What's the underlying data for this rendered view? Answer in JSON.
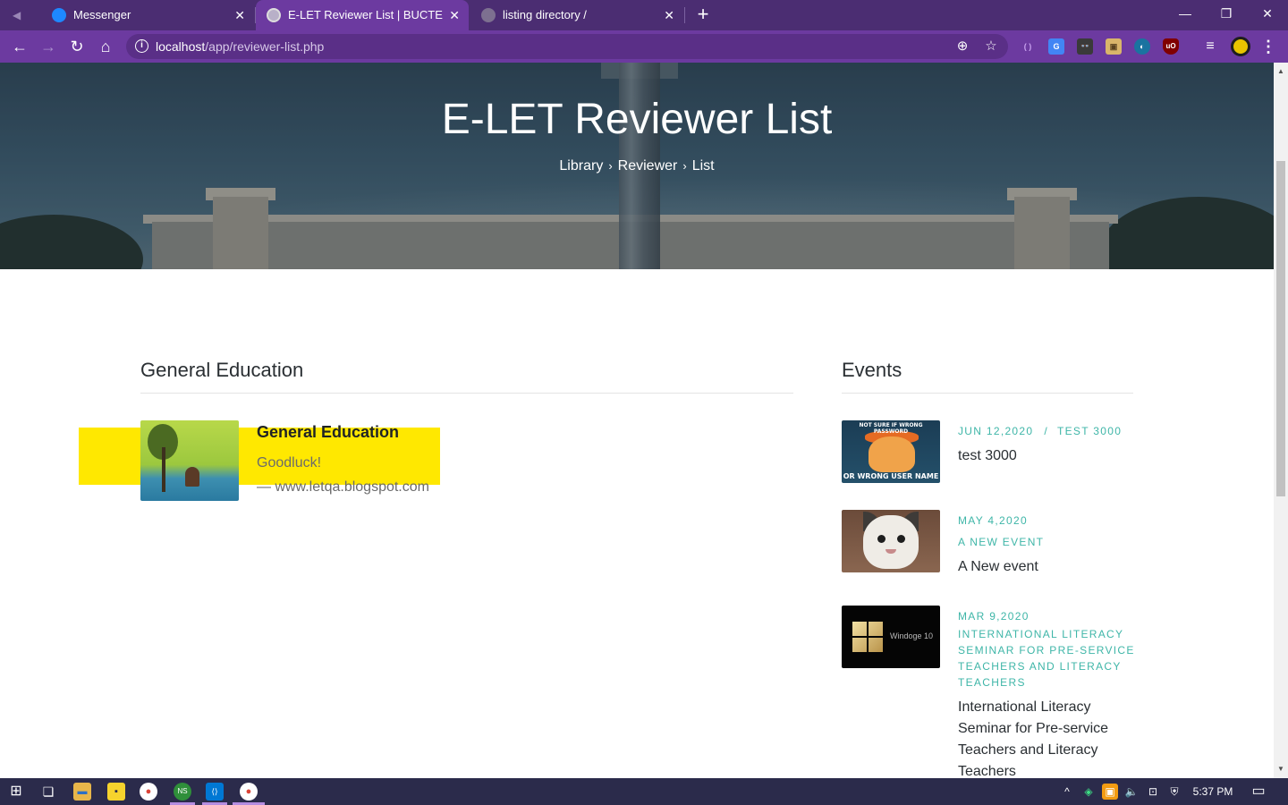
{
  "browser": {
    "tabs": [
      {
        "title": "Messenger",
        "close": "✕"
      },
      {
        "title": "E-LET Reviewer List | BUCTE",
        "close": "✕"
      },
      {
        "title": "listing directory /",
        "close": "✕"
      }
    ],
    "new_tab": "+",
    "window_controls": {
      "minimize": "—",
      "restore": "❐",
      "close": "✕"
    },
    "nav": {
      "back": "←",
      "forward": "→",
      "reload": "↻",
      "home": "⌂"
    },
    "url_host": "localhost",
    "url_path": "/app/reviewer-list.php",
    "omnibox_icons": {
      "zoom": "⊕",
      "star": "☆"
    },
    "extensions": [
      {
        "name": "code-extension-icon",
        "label": "( )",
        "color": "#9d6bd4"
      },
      {
        "name": "translate-extension-icon",
        "label": "G",
        "color": "#4285f4"
      },
      {
        "name": "spy-extension-icon",
        "label": "👓",
        "color": "#3a3a3a"
      },
      {
        "name": "box-extension-icon",
        "label": "▣",
        "color": "#d9b56a"
      },
      {
        "name": "sphere-extension-icon",
        "label": "◐",
        "color": "#1a73a0"
      },
      {
        "name": "ublock-extension-icon",
        "label": "uO",
        "color": "#800000"
      },
      {
        "name": "playlist-extension-icon",
        "label": "≡",
        "color": "#6c3aa0"
      },
      {
        "name": "profile-avatar-icon",
        "label": "",
        "color": "#e8c400"
      }
    ],
    "menu": "⋮"
  },
  "hero": {
    "title": "E-LET Reviewer List",
    "breadcrumb": [
      "Library",
      "Reviewer",
      "List"
    ],
    "separator": "›"
  },
  "main": {
    "section_title": "General Education",
    "post": {
      "title": "General Education",
      "description": "Goodluck!",
      "source": "— www.letqa.blogspot.com"
    }
  },
  "sidebar": {
    "title": "Events",
    "events": [
      {
        "date": "JUN 12,2020",
        "separator": "/",
        "category": "TEST 3000",
        "name": "test 3000",
        "image_caption_top": "NOT SURE IF WRONG PASSWORD",
        "image_caption_bottom": "OR WRONG USER NAME"
      },
      {
        "date": "MAY 4,2020",
        "category": "A NEW EVENT",
        "name": "A New event"
      },
      {
        "date": "MAR 9,2020",
        "category": "INTERNATIONAL LITERACY SEMINAR FOR PRE-SERVICE TEACHERS AND LITERACY TEACHERS",
        "name": "International Literacy Seminar for Pre-service Teachers and Literacy Teachers",
        "image_caption": "Windoge 10"
      }
    ]
  },
  "scrollbar": {
    "up": "▲",
    "down": "▼",
    "position": 0.14
  },
  "taskbar": {
    "apps": [
      {
        "name": "start-icon",
        "label": "⊞"
      },
      {
        "name": "task-view-icon",
        "label": "❏"
      },
      {
        "name": "file-explorer-icon",
        "label": "▬"
      },
      {
        "name": "sticky-notes-icon",
        "label": "▪"
      },
      {
        "name": "chrome-icon",
        "label": "●"
      },
      {
        "name": "node-icon",
        "label": "NS"
      },
      {
        "name": "vscode-icon",
        "label": "⟨⟩"
      },
      {
        "name": "chrome-active-icon",
        "label": "●"
      }
    ],
    "tray": [
      "^",
      "◈",
      "▣",
      "🔈",
      "⊡",
      "⛨"
    ],
    "clock": "5:37 PM",
    "notification": "▭"
  }
}
